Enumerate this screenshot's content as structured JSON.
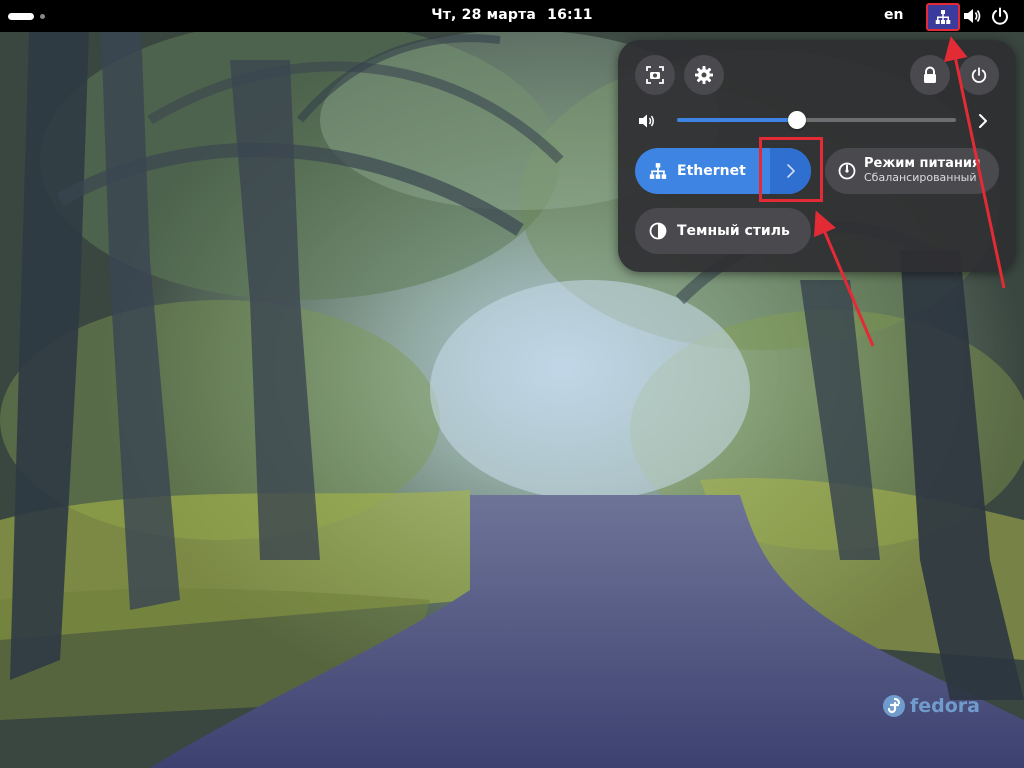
{
  "topbar": {
    "clock_day": "Чт, 28 марта",
    "clock_time": "16:11",
    "keyboard_layout": "en"
  },
  "quick_settings": {
    "volume_level": 0.43,
    "ethernet_label": "Ethernet",
    "power_mode_title": "Режим питания",
    "power_mode_value": "Сбалансированный",
    "dark_style_label": "Темный стиль"
  },
  "desktop": {
    "distro_logo_text": "fedora"
  },
  "colors": {
    "accent": "#3d84e3",
    "panel_bg": "#2e2e32",
    "annotation": "#e32b36"
  },
  "icons": {
    "activities": "activities-icon",
    "network_tray": "network-wired-icon",
    "volume_tray": "speaker-icon",
    "power_tray": "power-icon",
    "screenshot": "screenshot-icon",
    "settings": "gear-icon",
    "lock": "lock-icon",
    "power_off": "power-icon"
  }
}
